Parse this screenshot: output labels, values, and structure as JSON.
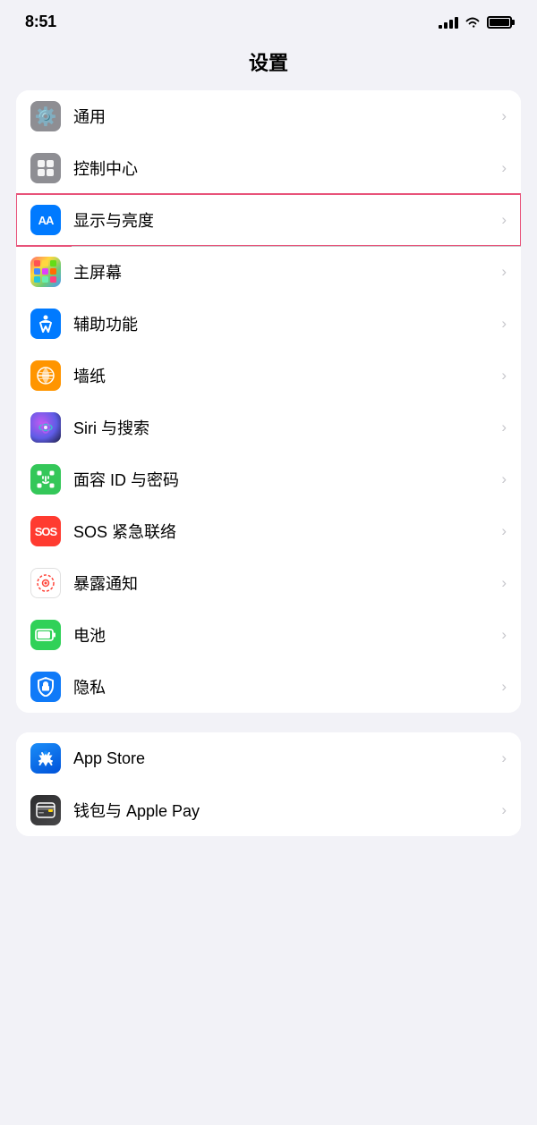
{
  "statusBar": {
    "time": "8:51",
    "signal": "full",
    "wifi": true,
    "battery": "full"
  },
  "pageTitle": "设置",
  "sections": [
    {
      "id": "general",
      "items": [
        {
          "id": "general",
          "label": "通用",
          "iconType": "gear",
          "iconBg": "gray",
          "highlighted": false
        },
        {
          "id": "control-center",
          "label": "控制中心",
          "iconType": "toggle",
          "iconBg": "gray",
          "highlighted": false
        },
        {
          "id": "display",
          "label": "显示与亮度",
          "iconType": "aa",
          "iconBg": "blue",
          "highlighted": true
        },
        {
          "id": "homescreen",
          "label": "主屏幕",
          "iconType": "homescreen",
          "iconBg": "colorful",
          "highlighted": false
        },
        {
          "id": "accessibility",
          "label": "辅助功能",
          "iconType": "accessibility",
          "iconBg": "blue2",
          "highlighted": false
        },
        {
          "id": "wallpaper",
          "label": "墙纸",
          "iconType": "flower",
          "iconBg": "orange",
          "highlighted": false
        },
        {
          "id": "siri",
          "label": "Siri 与搜索",
          "iconType": "siri",
          "iconBg": "siri",
          "highlighted": false
        },
        {
          "id": "faceid",
          "label": "面容 ID 与密码",
          "iconType": "faceid",
          "iconBg": "green",
          "highlighted": false
        },
        {
          "id": "sos",
          "label": "SOS 紧急联络",
          "iconType": "sos",
          "iconBg": "red",
          "highlighted": false
        },
        {
          "id": "exposure",
          "label": "暴露通知",
          "iconType": "exposure",
          "iconBg": "exposure",
          "highlighted": false
        },
        {
          "id": "battery",
          "label": "电池",
          "iconType": "battery",
          "iconBg": "green2",
          "highlighted": false
        },
        {
          "id": "privacy",
          "label": "隐私",
          "iconType": "hand",
          "iconBg": "privacy",
          "highlighted": false
        }
      ]
    },
    {
      "id": "apps",
      "items": [
        {
          "id": "appstore",
          "label": "App Store",
          "iconType": "appstore",
          "iconBg": "appstore",
          "highlighted": false
        },
        {
          "id": "wallet",
          "label": "钱包与 Apple Pay",
          "iconType": "wallet",
          "iconBg": "wallet",
          "highlighted": false
        }
      ]
    }
  ],
  "chevron": "›"
}
